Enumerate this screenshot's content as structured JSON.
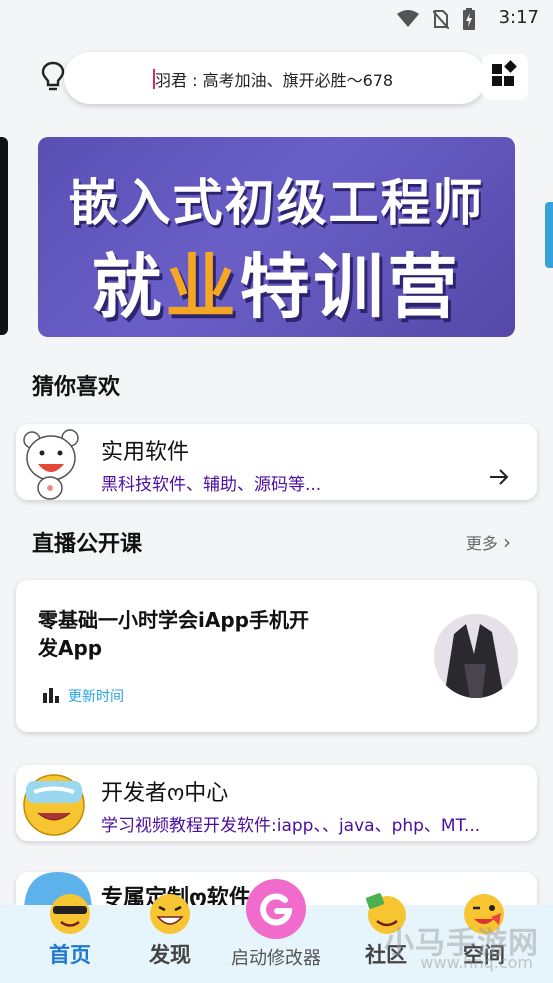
{
  "status_bar": {
    "time": "3:17"
  },
  "search": {
    "text": "羽君 : 高考加油、旗开必胜～678"
  },
  "banner": {
    "line1": "嵌入式初级工程师",
    "line2_a": "就",
    "line2_hl": "业",
    "line2_b": "特训营"
  },
  "section_like": {
    "title": "猜你喜欢"
  },
  "card_software": {
    "title": "实用软件",
    "subtitle": "黑科技软件、辅助、源码等..."
  },
  "section_live": {
    "title": "直播公开课",
    "more": "更多"
  },
  "course": {
    "title": "零基础一小时学会iApp手机开发App",
    "updated": "更新时间"
  },
  "card_dev": {
    "title": "开发者ო中心",
    "subtitle": "学习视频教程开发软件:iapp、、java、php、MT..."
  },
  "card_custom": {
    "title": "专属定制ო软件"
  },
  "bottom_nav": {
    "items": [
      {
        "label": "首页"
      },
      {
        "label": "发现"
      },
      {
        "label": "启动修改器"
      },
      {
        "label": "社区"
      },
      {
        "label": "空间"
      }
    ]
  },
  "watermark": {
    "text": "小马手游网",
    "sub": "www.hnq.com"
  },
  "colors": {
    "accent": "#1e78d2",
    "subtitle": "#4b0fa0",
    "banner": "#5a4fb3",
    "update": "#27a4e0",
    "nav_bg": "#e6f4fb"
  }
}
